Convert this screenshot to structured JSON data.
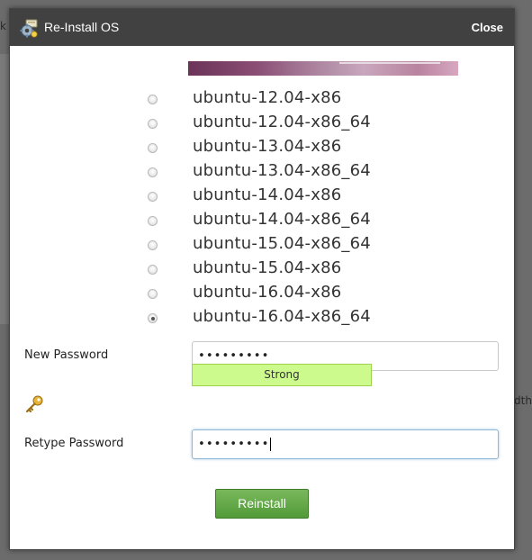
{
  "dialog": {
    "title": "Re-Install OS",
    "close_label": "Close",
    "title_icon": "reinstall-gear-icon"
  },
  "os_options": [
    {
      "label": "ubuntu-12.04-x86",
      "checked": false
    },
    {
      "label": "ubuntu-12.04-x86_64",
      "checked": false
    },
    {
      "label": "ubuntu-13.04-x86",
      "checked": false
    },
    {
      "label": "ubuntu-13.04-x86_64",
      "checked": false
    },
    {
      "label": "ubuntu-14.04-x86",
      "checked": false
    },
    {
      "label": "ubuntu-14.04-x86_64",
      "checked": false
    },
    {
      "label": "ubuntu-15.04-x86_64",
      "checked": false
    },
    {
      "label": "ubuntu-15.04-x86",
      "checked": false
    },
    {
      "label": "ubuntu-16.04-x86",
      "checked": false
    },
    {
      "label": "ubuntu-16.04-x86_64",
      "checked": true
    }
  ],
  "form": {
    "new_password_label": "New Password",
    "new_password_value": "•••••••••",
    "strength_label": "Strong",
    "generate_icon": "key-icon",
    "retype_password_label": "Retype Password",
    "retype_password_value": "•••••••••",
    "submit_label": "Reinstall"
  },
  "background": {
    "fragment_1": "k",
    "fragment_2": "dth"
  },
  "colors": {
    "titlebar": "#414141",
    "strength_fill": "#cdfa8c",
    "button_green": "#5fa543"
  }
}
